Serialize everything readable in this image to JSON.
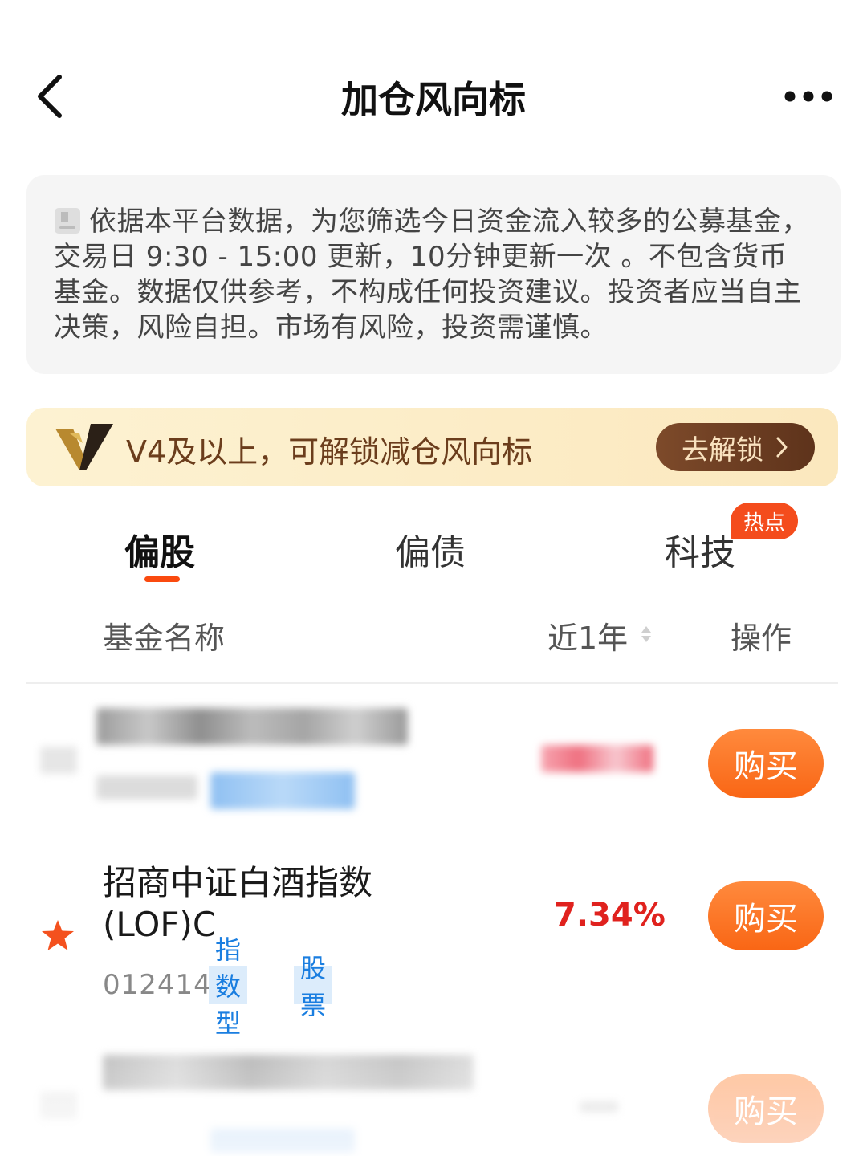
{
  "header": {
    "title": "加仓风向标"
  },
  "notice": {
    "text": "依据本平台数据，为您筛选今日资金流入较多的公募基金，交易日 9:30 - 15:00 更新，10分钟更新一次 。不包含货币基金。数据仅供参考，不构成任何投资建议。投资者应当自主决策，风险自担。市场有风险，投资需谨慎。"
  },
  "banner": {
    "text": "V4及以上，可解锁减仓风向标",
    "button_label": "去解锁"
  },
  "tabs": [
    {
      "label": "偏股",
      "active": true
    },
    {
      "label": "偏债",
      "active": false
    },
    {
      "label": "科技",
      "active": false,
      "badge": "热点"
    }
  ],
  "table": {
    "headers": {
      "name": "基金名称",
      "return": "近1年",
      "action": "操作"
    },
    "rows": [
      {
        "name": "招商中证白酒指数(LOF)C",
        "code": "012414",
        "tags": [
          "指数型",
          "股票"
        ],
        "return": "7.34%",
        "action_label": "购买"
      }
    ],
    "blurred_action_label": "购买"
  },
  "colors": {
    "accent": "#fa4a0f",
    "positive": "#e0221e",
    "tag_blue": "#1a7ee0",
    "vip_brown": "#6b3d1c"
  }
}
